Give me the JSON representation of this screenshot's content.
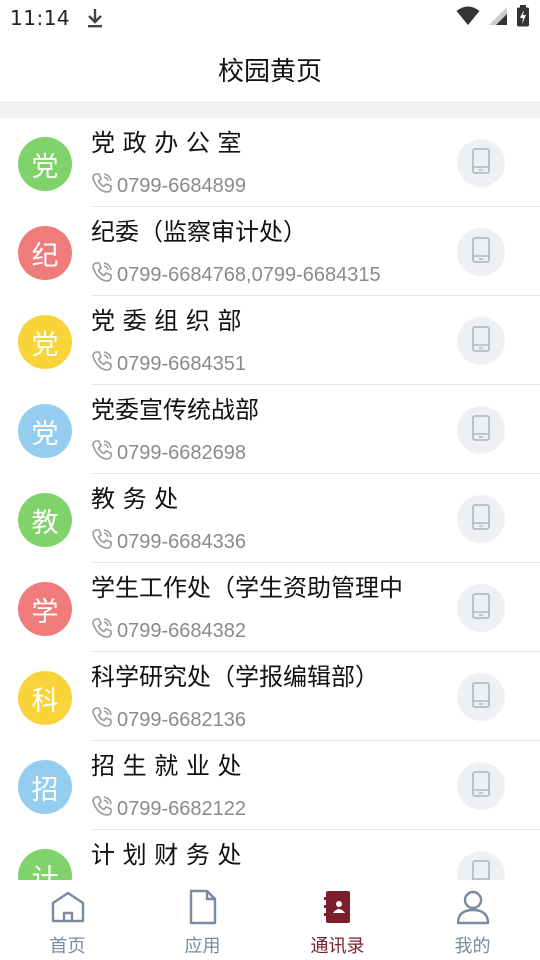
{
  "status": {
    "time": "11:14"
  },
  "header": {
    "title": "校园黄页"
  },
  "contacts": [
    {
      "avatar": "党",
      "color": "#7fd36a",
      "name": "党 政 办 公 室",
      "phone": "0799-6684899"
    },
    {
      "avatar": "纪",
      "color": "#f07b7b",
      "name": "纪委（监察审计处）",
      "phone": "0799-6684768,0799-6684315"
    },
    {
      "avatar": "党",
      "color": "#f9d33a",
      "name": "党 委 组 织 部",
      "phone": "0799-6684351"
    },
    {
      "avatar": "党",
      "color": "#95cdf0",
      "name": "党委宣传统战部",
      "phone": "0799-6682698"
    },
    {
      "avatar": "教",
      "color": "#7fd36a",
      "name": "教  务  处",
      "phone": "0799-6684336"
    },
    {
      "avatar": "学",
      "color": "#f07b7b",
      "name": "学生工作处（学生资助管理中",
      "phone": "0799-6684382"
    },
    {
      "avatar": "科",
      "color": "#f9d33a",
      "name": "科学研究处（学报编辑部）",
      "phone": "0799-6682136"
    },
    {
      "avatar": "招",
      "color": "#95cdf0",
      "name": "招 生 就 业 处",
      "phone": "0799-6682122"
    },
    {
      "avatar": "计",
      "color": "#7fd36a",
      "name": "计 划 财 务 处",
      "phone": ""
    }
  ],
  "tabs": [
    {
      "label": "首页",
      "icon": "home-icon"
    },
    {
      "label": "应用",
      "icon": "document-icon"
    },
    {
      "label": "通讯录",
      "icon": "contacts-book-icon",
      "active": true
    },
    {
      "label": "我的",
      "icon": "person-icon"
    }
  ]
}
